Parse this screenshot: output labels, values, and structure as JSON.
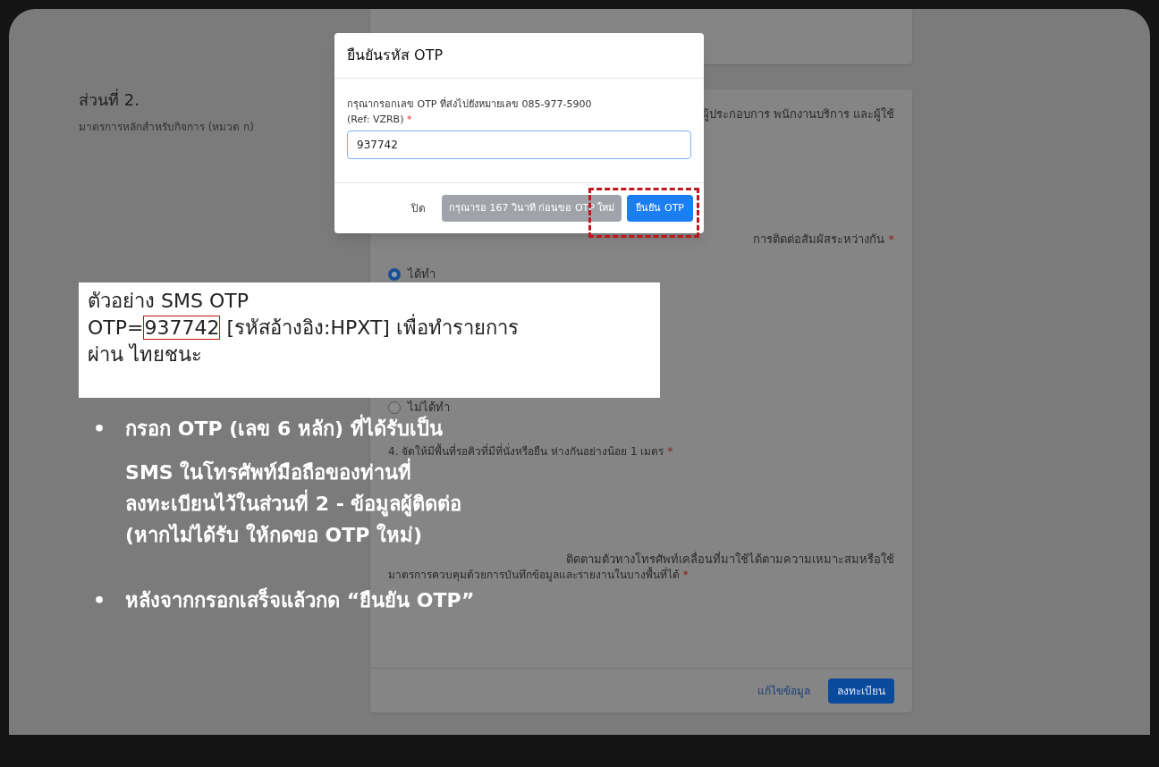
{
  "section": {
    "title": "ส่วนที่ 2.",
    "subtitle": "มาตรการหลักสำหรับกิจการ (หมวด ก)"
  },
  "card_items": [
    {
      "kind": "fragment",
      "text": "ผู้ประกอบการ พนักงานบริการ และผู้ใช้"
    },
    {
      "kind": "fragment",
      "text": "การติดต่อสัมผัสระหว่างกัน",
      "mark": "*"
    },
    {
      "kind": "radio",
      "label": "ได้ทำ",
      "selected": true
    },
    {
      "kind": "radio",
      "label": "ไม่ได้ทำ",
      "selected": false
    },
    {
      "kind": "question",
      "text": "4. จัดให้มีพื้นที่รอคิวที่มีที่นั่งหรือยืน ห่างกันอย่างน้อย 1 เมตร",
      "mark": "*"
    },
    {
      "kind": "fragment",
      "text": "ติดตามตัวทางโทรศัพท์เคลื่อนที่มาใช้ได้ตามความเหมาะสมหรือใช้"
    },
    {
      "kind": "question",
      "text": "มาตรการควบคุมด้วยการบันทึกข้อมูลและรายงานในบางพื้นที่ได้",
      "mark": "*"
    }
  ],
  "card_footer": {
    "edit_link": "แก้ไขข้อมูล",
    "submit_button": "ลงทะเบียน"
  },
  "modal": {
    "title": "ยืนยันรหัส OTP",
    "prompt": "กรุณากรอกเลข OTP ที่ส่งไปยังหมายเลข 085-977-5900",
    "ref": "(Ref: VZRB)",
    "mark": "*",
    "value": "937742",
    "close_button": "ปิด",
    "resend_button": {
      "label": "กรุณารอ 167 วินาที ก่อนขอ OTP ใหม่",
      "disabled": true
    },
    "confirm_button": "ยืนยัน OTP",
    "highlight_confirm": true
  },
  "sms_example": {
    "title": "ตัวอย่าง SMS OTP",
    "prefix": "OTP=",
    "code": "937742",
    "suffix": " [รหัสอ้างอิง:HPXT] เพื่อทำรายการ",
    "continuation": "ผ่าน ไทยชนะ"
  },
  "instructions": [
    {
      "bullet": "•",
      "lines": [
        "กรอก OTP (เลข 6 หลัก) ที่ได้รับเป็น",
        "SMS ในโทรศัพท์มือถือของท่านที่",
        "ลงทะเบียนไว้ในส่วนที่ 2 - ข้อมูลผู้ติดต่อ",
        "(หากไม่ได้รับ ให้กดขอ OTP ใหม่)"
      ]
    },
    {
      "bullet": "•",
      "lines": [
        "หลังจากกรอกเสร็จแล้วกด “ยืนยัน OTP”"
      ]
    }
  ]
}
